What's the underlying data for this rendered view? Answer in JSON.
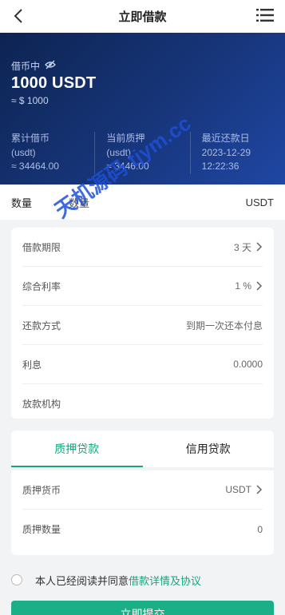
{
  "header": {
    "title": "立即借款"
  },
  "hero": {
    "label": "借币中",
    "amount": "1000 USDT",
    "approx": "≈ $ 1000",
    "stats": [
      {
        "label": "累计借币",
        "unit": "(usdt)",
        "value": "≈ 34464.00"
      },
      {
        "label": "当前质押",
        "unit": "(usdt)",
        "value": "≈ 3446.00"
      },
      {
        "label": "最近还款日",
        "date": "2023-12-29",
        "time": "12:22:36"
      }
    ]
  },
  "qty": {
    "label": "数量",
    "value": "数量",
    "unit": "USDT"
  },
  "loan": {
    "rows": [
      {
        "label": "借款期限",
        "value": "3 天"
      },
      {
        "label": "综合利率",
        "value": "1 %"
      },
      {
        "label": "还款方式",
        "value": "到期一次还本付息"
      },
      {
        "label": "利息",
        "value": "0.0000"
      },
      {
        "label": "放款机构",
        "value": ""
      }
    ]
  },
  "tabs": [
    {
      "label": "质押贷款"
    },
    {
      "label": "信用贷款"
    }
  ],
  "pledge": {
    "rows": [
      {
        "label": "质押货币",
        "value": "USDT"
      },
      {
        "label": "质押数量",
        "value": "0"
      }
    ]
  },
  "agreement": {
    "text": "本人已经阅读并同意",
    "link": "借款详情及协议"
  },
  "submit": {
    "label": "立即提交"
  },
  "watermark": {
    "text": "天机源码 tjym.cc"
  },
  "colors": {
    "accent": "#17a57f",
    "hero_dark": "#0d2452",
    "hero_light": "#1f47a4"
  }
}
